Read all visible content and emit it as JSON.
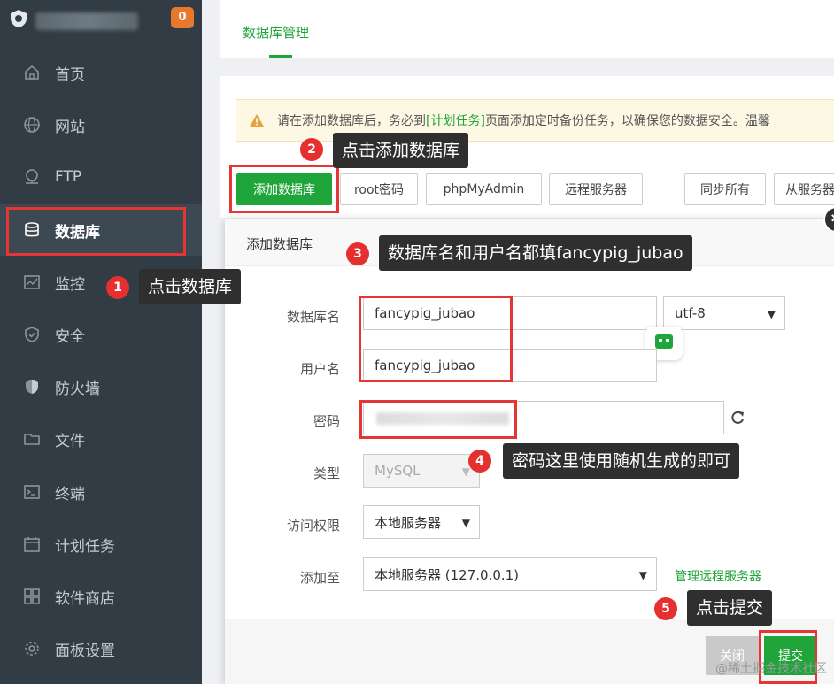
{
  "sidebar": {
    "badge": "0",
    "items": [
      {
        "label": "首页",
        "icon": "home-icon"
      },
      {
        "label": "网站",
        "icon": "globe-icon"
      },
      {
        "label": "FTP",
        "icon": "ftp-icon"
      },
      {
        "label": "数据库",
        "icon": "database-icon"
      },
      {
        "label": "监控",
        "icon": "monitor-icon"
      },
      {
        "label": "安全",
        "icon": "shield-check-icon"
      },
      {
        "label": "防火墙",
        "icon": "firewall-icon"
      },
      {
        "label": "文件",
        "icon": "folder-icon"
      },
      {
        "label": "终端",
        "icon": "terminal-icon"
      },
      {
        "label": "计划任务",
        "icon": "calendar-icon"
      },
      {
        "label": "软件商店",
        "icon": "apps-icon"
      },
      {
        "label": "面板设置",
        "icon": "gear-icon"
      }
    ]
  },
  "main": {
    "tab": "数据库管理",
    "warning": {
      "prefix": "请在添加数据库后，务必到",
      "link": "[计划任务]",
      "suffix": "页面添加定时备份任务，以确保您的数据安全。温馨"
    },
    "buttons": [
      "添加数据库",
      "root密码",
      "phpMyAdmin",
      "远程服务器",
      "同步所有",
      "从服务器"
    ]
  },
  "dialog": {
    "title": "添加数据库",
    "fields": {
      "db_name_label": "数据库名",
      "db_name_value": "fancypig_jubao",
      "charset": "utf-8",
      "user_label": "用户名",
      "user_value": "fancypig_jubao",
      "password_label": "密码",
      "type_label": "类型",
      "type_value": "MySQL",
      "access_label": "访问权限",
      "access_value": "本地服务器",
      "addto_label": "添加至",
      "addto_value": "本地服务器 (127.0.0.1)",
      "manage_remote": "管理远程服务器"
    },
    "footer": {
      "close": "关闭",
      "submit": "提交"
    }
  },
  "annotations": [
    {
      "num": "1",
      "text": "点击数据库"
    },
    {
      "num": "2",
      "text": "点击添加数据库"
    },
    {
      "num": "3",
      "text": "数据库名和用户名都填fancypig_jubao"
    },
    {
      "num": "4",
      "text": "密码这里使用随机生成的即可"
    },
    {
      "num": "5",
      "text": "点击提交"
    }
  ],
  "watermark": "@稀土掘金技术社区",
  "colors": {
    "accent": "#20a53a",
    "sidebar": "#313c45",
    "callout_red": "#e63535"
  }
}
